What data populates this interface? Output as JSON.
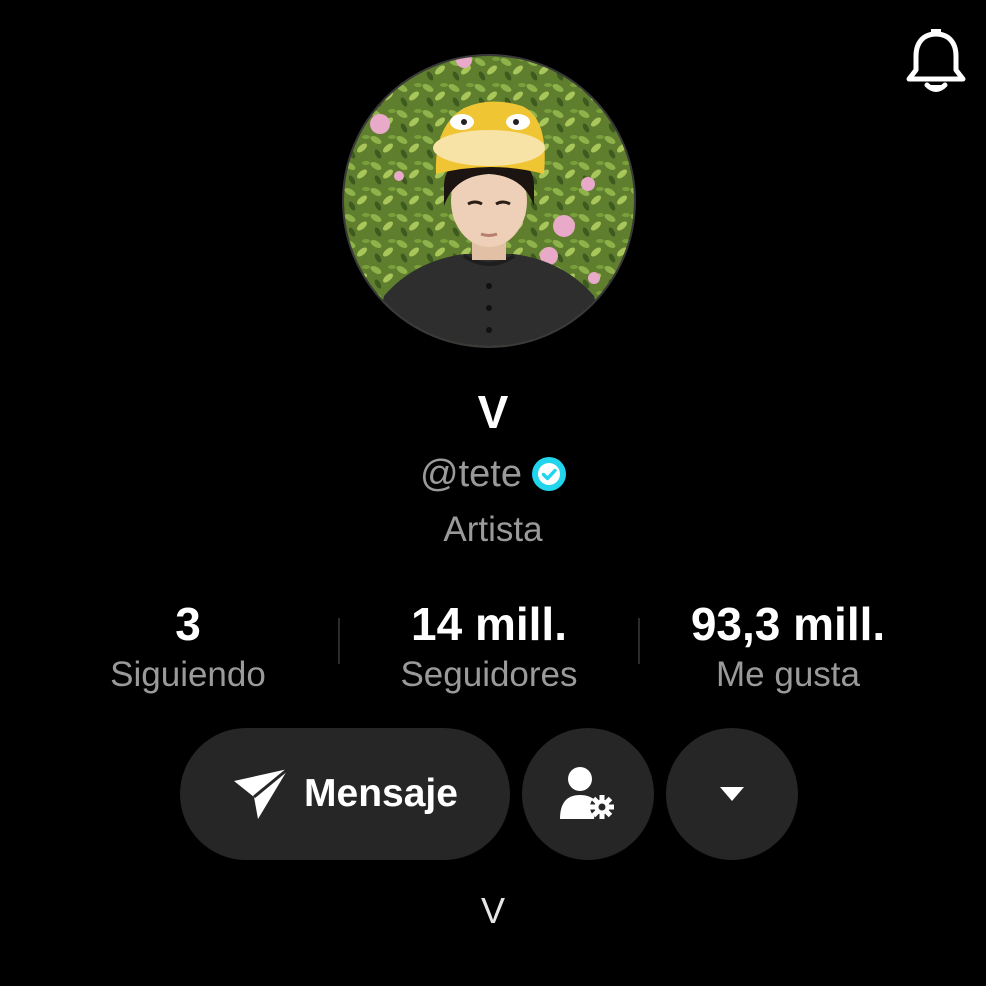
{
  "header": {
    "notifications_icon": "bell-icon"
  },
  "profile": {
    "display_name": "V",
    "handle": "@tete",
    "verified_icon": "verified-badge-icon",
    "category": "Artista",
    "bio": "V"
  },
  "stats": [
    {
      "value": "3",
      "label": "Siguiendo"
    },
    {
      "value": "14 mill.",
      "label": "Seguidores"
    },
    {
      "value": "93,3 mill.",
      "label": "Me gusta"
    }
  ],
  "actions": {
    "message_label": "Mensaje",
    "message_icon": "send-icon",
    "follow_settings_icon": "user-gear-icon",
    "more_icon": "caret-down-icon"
  },
  "colors": {
    "background": "#000000",
    "button": "#262626",
    "secondary_text": "#9a9a9a",
    "verified": "#20d5ec"
  }
}
